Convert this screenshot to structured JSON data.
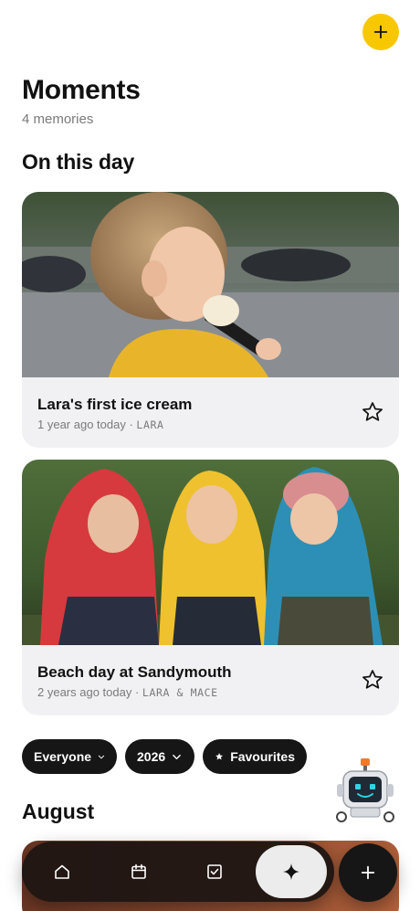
{
  "header": {
    "title": "Moments",
    "subtitle": "4 memories",
    "add_icon": "plus-icon",
    "accent": "#f7c800"
  },
  "on_this_day": {
    "heading": "On this day",
    "cards": [
      {
        "title": "Lara's first ice cream",
        "when": "1 year ago today",
        "sep": " · ",
        "who": "LARA",
        "star_icon": "star-outline-icon"
      },
      {
        "title": "Beach day at Sandymouth",
        "when": "2 years ago today",
        "sep": " · ",
        "who": "LARA & MACE",
        "star_icon": "star-outline-icon"
      }
    ]
  },
  "filters": {
    "people": "Everyone",
    "year": "2026",
    "favourites": "Favourites"
  },
  "month_heading": "August",
  "nav": {
    "items": [
      "home-icon",
      "calendar-icon",
      "checkbox-icon",
      "sparkle-icon"
    ],
    "add_icon": "plus-icon"
  }
}
